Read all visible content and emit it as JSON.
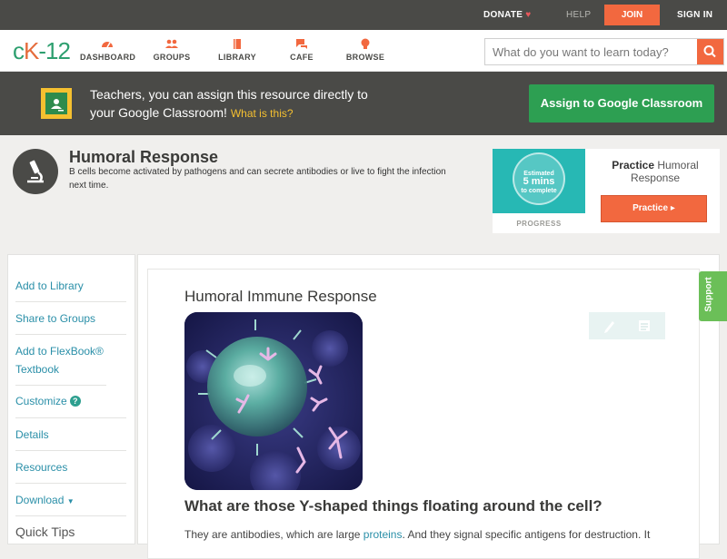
{
  "topbar": {
    "donate": "DONATE",
    "help": "HELP",
    "join": "JOIN",
    "signin": "SIGN IN"
  },
  "nav": {
    "logo": {
      "part1": "c",
      "part2": "K",
      "part3": "-12"
    },
    "items": [
      {
        "label": "DASHBOARD",
        "icon": "dashboard-icon"
      },
      {
        "label": "GROUPS",
        "icon": "groups-icon"
      },
      {
        "label": "LIBRARY",
        "icon": "library-icon"
      },
      {
        "label": "CAFE",
        "icon": "cafe-icon"
      },
      {
        "label": "BROWSE",
        "icon": "browse-icon"
      }
    ],
    "search_placeholder": "What do you want to learn today?"
  },
  "banner": {
    "line1": "Teachers, you can assign this resource directly to",
    "line2": "your Google Classroom!",
    "what": "What is this?",
    "assign": "Assign to Google Classroom"
  },
  "concept": {
    "title": "Humoral Response",
    "description": "B cells become activated by pathogens and can secrete antibodies or live to fight the infection next time."
  },
  "practice": {
    "estimated": "Estimated",
    "mins": "5 mins",
    "complete": "to complete",
    "progress": "PROGRESS",
    "title_bold": "Practice",
    "title_rest": "Humoral Response",
    "button": "Practice"
  },
  "sidebar": {
    "items": [
      "Add to Library",
      "Share to Groups",
      "Add to FlexBook® Textbook",
      "Customize",
      "Details",
      "Resources",
      "Download",
      "Quick Tips"
    ]
  },
  "content": {
    "section_title": "Humoral Immune Response",
    "question": "What are those Y-shaped things floating around the cell?",
    "para_before": "They are antibodies, which are large ",
    "para_link": "proteins",
    "para_after": ". And they signal specific antigens for destruction. It"
  },
  "support": "Support",
  "colors": {
    "accent_orange": "#f2683f",
    "green": "#2d9f52",
    "link": "#2a8fa8",
    "dark_bar": "#4a4a47"
  }
}
